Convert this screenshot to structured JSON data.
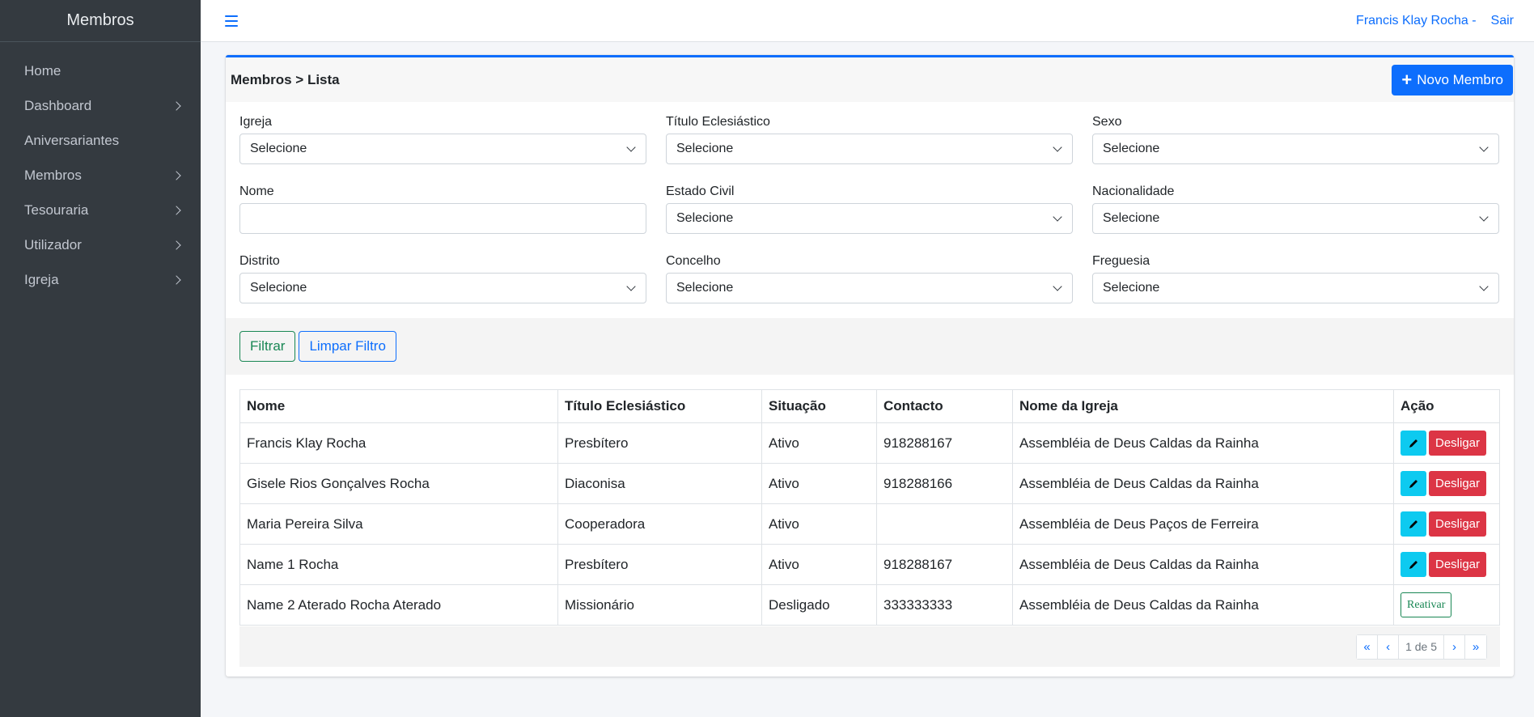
{
  "sidebar": {
    "brand": "Membros",
    "items": [
      {
        "label": "Home",
        "has_children": false
      },
      {
        "label": "Dashboard",
        "has_children": true
      },
      {
        "label": "Aniversariantes",
        "has_children": false
      },
      {
        "label": "Membros",
        "has_children": true
      },
      {
        "label": "Tesouraria",
        "has_children": true
      },
      {
        "label": "Utilizador",
        "has_children": true
      },
      {
        "label": "Igreja",
        "has_children": true
      }
    ]
  },
  "topbar": {
    "user_name": "Francis Klay Rocha -",
    "logout": "Sair"
  },
  "card": {
    "breadcrumb": "Membros > Lista",
    "new_button": "Novo Membro"
  },
  "filters": {
    "igreja": {
      "label": "Igreja",
      "value": "Selecione"
    },
    "titulo": {
      "label": "Título Eclesiástico",
      "value": "Selecione"
    },
    "sexo": {
      "label": "Sexo",
      "value": "Selecione"
    },
    "nome": {
      "label": "Nome",
      "value": ""
    },
    "estado_civil": {
      "label": "Estado Civil",
      "value": "Selecione"
    },
    "nacionalidade": {
      "label": "Nacionalidade",
      "value": "Selecione"
    },
    "distrito": {
      "label": "Distrito",
      "value": "Selecione"
    },
    "concelho": {
      "label": "Concelho",
      "value": "Selecione"
    },
    "freguesia": {
      "label": "Freguesia",
      "value": "Selecione"
    }
  },
  "actions": {
    "filter": "Filtrar",
    "clear": "Limpar Filtro"
  },
  "table": {
    "columns": [
      "Nome",
      "Título Eclesiástico",
      "Situação",
      "Contacto",
      "Nome da Igreja",
      "Ação"
    ],
    "rows": [
      {
        "nome": "Francis Klay Rocha",
        "titulo": "Presbítero",
        "situacao": "Ativo",
        "contacto": "918288167",
        "igreja": "Assembléia de Deus Caldas da Rainha",
        "action": "Desligar"
      },
      {
        "nome": "Gisele Rios Gonçalves Rocha",
        "titulo": "Diaconisa",
        "situacao": "Ativo",
        "contacto": "918288166",
        "igreja": "Assembléia de Deus Caldas da Rainha",
        "action": "Desligar"
      },
      {
        "nome": "Maria Pereira Silva",
        "titulo": "Cooperadora",
        "situacao": "Ativo",
        "contacto": "",
        "igreja": "Assembléia de Deus Paços de Ferreira",
        "action": "Desligar"
      },
      {
        "nome": "Name 1 Rocha",
        "titulo": "Presbítero",
        "situacao": "Ativo",
        "contacto": "918288167",
        "igreja": "Assembléia de Deus Caldas da Rainha",
        "action": "Desligar"
      },
      {
        "nome": "Name 2 Aterado Rocha Aterado",
        "titulo": "Missionário",
        "situacao": "Desligado",
        "contacto": "333333333",
        "igreja": "Assembléia de Deus Caldas da Rainha",
        "action": "Reativar"
      }
    ]
  },
  "pagination": {
    "first": "«",
    "prev": "‹",
    "info": "1 de 5",
    "next": "›",
    "last": "»"
  },
  "colors": {
    "primary": "#0d6efd",
    "info": "#0dcaf0",
    "danger": "#dc3545",
    "success": "#198754",
    "sidebar": "#343a40"
  }
}
